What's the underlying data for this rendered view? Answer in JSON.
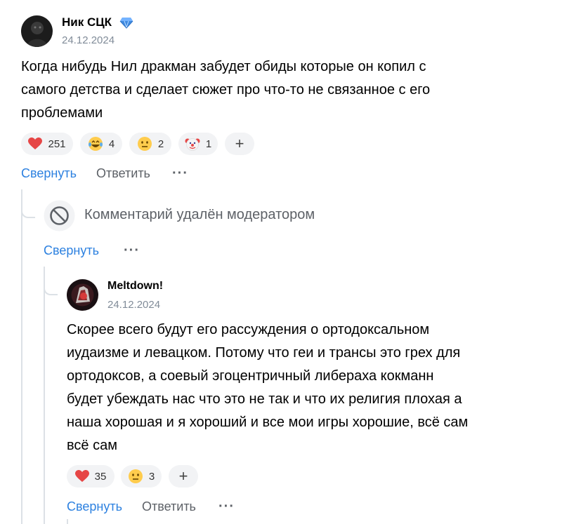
{
  "comment1": {
    "author": "Ник СЦК",
    "date": "24.12.2024",
    "text_lines": [
      "Когда нибудь Нил дракман забудет обиды которые он копил с",
      "самого детства и сделает сюжет про что-то не связанное с его",
      "проблемами"
    ],
    "reactions": [
      {
        "icon": "heart-icon",
        "count": "251"
      },
      {
        "icon": "laughing-tears-emoji-icon",
        "count": "4"
      },
      {
        "icon": "neutral-face-emoji-icon",
        "count": "2"
      },
      {
        "icon": "clown-face-emoji-icon",
        "count": "1"
      }
    ],
    "add_reaction": "+",
    "collapse": "Свернуть",
    "reply": "Ответить",
    "more": "···"
  },
  "deleted": {
    "text": "Комментарий удалён модератором",
    "collapse": "Свернуть",
    "more": "···"
  },
  "comment2": {
    "author": "Meltdown!",
    "date": "24.12.2024",
    "text_lines": [
      "Скорее всего будут его рассуждения о ортодоксальном",
      "иудаизме и левацком. Потому что геи и трансы это грех для",
      "ортодоксов, а соевый эгоцентричный либераха кокманн",
      "будет убеждать нас что это не так и что их религия плохая а",
      "наша хорошая и я хороший и все мои игры хорошие, всё сам",
      "всё сам"
    ],
    "reactions": [
      {
        "icon": "heart-icon",
        "count": "35"
      },
      {
        "icon": "neutral-face-emoji-icon",
        "count": "3"
      }
    ],
    "add_reaction": "+",
    "collapse": "Свернуть",
    "reply": "Ответить",
    "more": "···"
  },
  "colors": {
    "link": "#2d81e0",
    "secondary": "#818c99",
    "pill_bg": "#f2f3f5",
    "thread_line": "#dce1e6",
    "heart": "#e64646",
    "verified": "#3f8ae0"
  }
}
